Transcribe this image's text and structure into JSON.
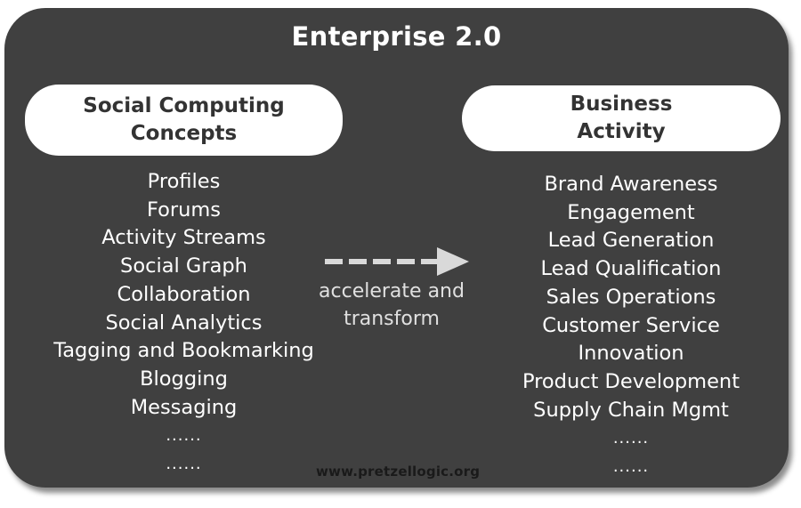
{
  "title": "Enterprise 2.0",
  "left_column": {
    "heading": [
      "Social Computing",
      "Concepts"
    ],
    "items": [
      "Profiles",
      "Forums",
      "Activity Streams",
      "Social Graph",
      "Collaboration",
      "Social Analytics",
      "Tagging and Bookmarking",
      "Blogging",
      "Messaging",
      "......",
      "......"
    ]
  },
  "right_column": {
    "heading": [
      "Business",
      "Activity"
    ],
    "items": [
      "Brand Awareness",
      "Engagement",
      "Lead Generation",
      "Lead Qualification",
      "Sales Operations",
      "Customer Service",
      "Innovation",
      "Product Development",
      "Supply Chain Mgmt",
      "......",
      "......"
    ]
  },
  "connector": {
    "icon": "dashed-arrow-right-icon",
    "label": [
      "accelerate and",
      "transform"
    ]
  },
  "footer": {
    "url": "www.pretzellogic.org"
  },
  "colors": {
    "panel_background": "#404040",
    "pill_background": "#ffffff",
    "heading_text": "#333333",
    "list_text": "#ffffff",
    "arrow": "#d9d9d9",
    "footer_text": "#1a1a1a"
  }
}
